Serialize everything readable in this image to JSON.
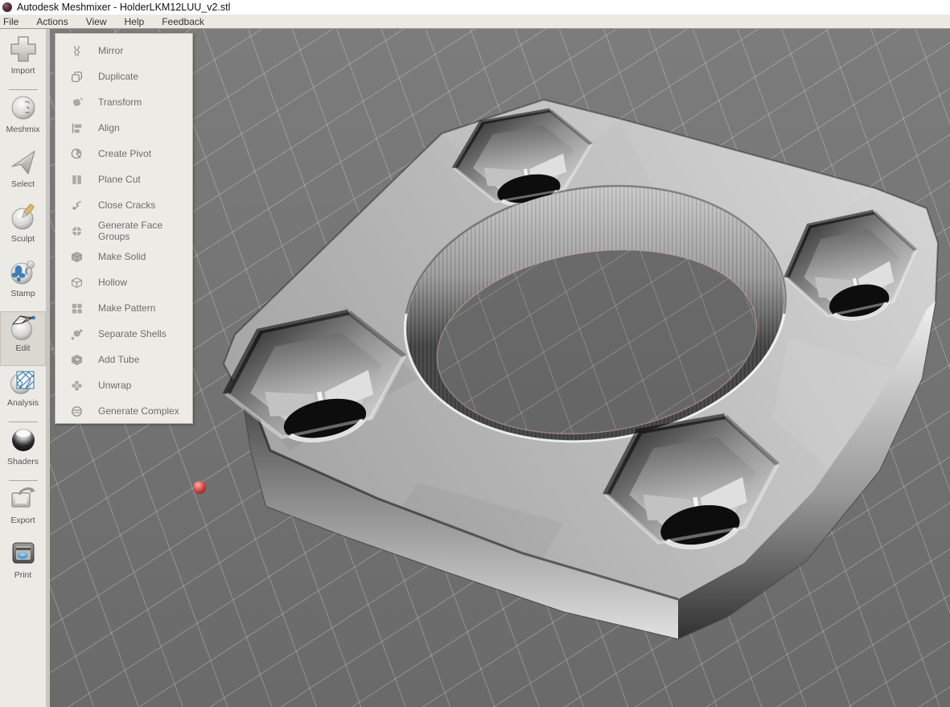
{
  "window": {
    "title": "Autodesk Meshmixer - HolderLKM12LUU_v2.stl"
  },
  "menu_bar": {
    "items": [
      {
        "label": "File"
      },
      {
        "label": "Actions"
      },
      {
        "label": "View"
      },
      {
        "label": "Help"
      },
      {
        "label": "Feedback"
      }
    ]
  },
  "sidebar": {
    "tools": [
      {
        "label": "Import",
        "active": false
      },
      {
        "label": "Meshmix",
        "active": false
      },
      {
        "label": "Select",
        "active": false
      },
      {
        "label": "Sculpt",
        "active": false
      },
      {
        "label": "Stamp",
        "active": false
      },
      {
        "label": "Edit",
        "active": true
      },
      {
        "label": "Analysis",
        "active": false
      },
      {
        "label": "Shaders",
        "active": false
      },
      {
        "label": "Export",
        "active": false
      },
      {
        "label": "Print",
        "active": false
      }
    ]
  },
  "edit_menu": {
    "items": [
      {
        "label": "Mirror"
      },
      {
        "label": "Duplicate"
      },
      {
        "label": "Transform"
      },
      {
        "label": "Align"
      },
      {
        "label": "Create Pivot"
      },
      {
        "label": "Plane Cut"
      },
      {
        "label": "Close Cracks"
      },
      {
        "label": "Generate Face Groups"
      },
      {
        "label": "Make Solid"
      },
      {
        "label": "Hollow"
      },
      {
        "label": "Make Pattern"
      },
      {
        "label": "Separate Shells"
      },
      {
        "label": "Add Tube"
      },
      {
        "label": "Unwrap"
      },
      {
        "label": "Generate Complex"
      }
    ]
  },
  "viewport": {
    "model_file": "HolderLKM12LUU_v2.stl",
    "selection_dot_color": "#e0514e",
    "colors": {
      "background_top": "#7c7c7c",
      "background_bottom": "#6a6a6a",
      "grid_line": "#9b9b9b",
      "model_base": "#b9b9b9",
      "inner_rim_tint": "#d0a3a3"
    }
  },
  "chrome_colors": {
    "titlebar_bg": "#ffffff",
    "menubar_bg": "#ece9e3",
    "sidebar_bg": "#eceae5",
    "panel_bg": "#edebe5",
    "active_tool_bg": "#dbd7d1",
    "accent_blue": "#2e76ad"
  }
}
